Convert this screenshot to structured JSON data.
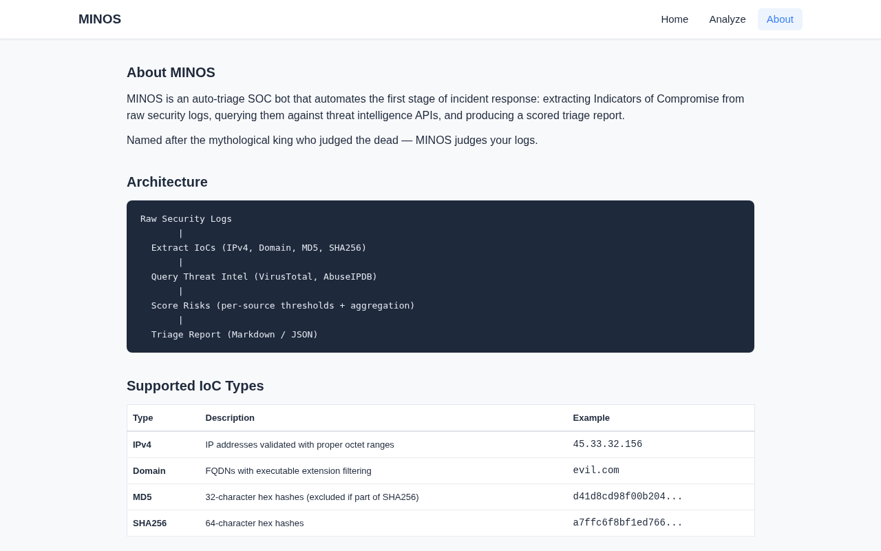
{
  "navbar": {
    "brand": "MINOS",
    "links": [
      {
        "label": "Home",
        "selected": false
      },
      {
        "label": "Analyze",
        "selected": false
      },
      {
        "label": "About",
        "selected": true
      }
    ]
  },
  "about": {
    "title": "About MINOS",
    "paragraphs": [
      "MINOS is an auto-triage SOC bot that automates the first stage of incident response: extracting Indicators of Compromise from raw security logs, querying them against threat intelligence APIs, and producing a scored triage report.",
      "Named after the mythological king who judged the dead — MINOS judges your logs."
    ]
  },
  "architecture": {
    "title": "Architecture",
    "lines": [
      {
        "kind": "source",
        "text": "Raw Security Logs"
      },
      {
        "kind": "connector",
        "text": "|"
      },
      {
        "kind": "step",
        "text": "Extract IoCs (IPv4, Domain, MD5, SHA256)"
      },
      {
        "kind": "connector",
        "text": "|"
      },
      {
        "kind": "step",
        "text": "Query Threat Intel (VirusTotal, AbuseIPDB)"
      },
      {
        "kind": "connector",
        "text": "|"
      },
      {
        "kind": "step",
        "text": "Score Risks (per-source thresholds + aggregation)"
      },
      {
        "kind": "connector",
        "text": "|"
      },
      {
        "kind": "step",
        "text": "Triage Report (Markdown / JSON)"
      }
    ]
  },
  "ioc_types": {
    "title": "Supported IoC Types",
    "columns": [
      "Type",
      "Description",
      "Example"
    ],
    "rows": [
      {
        "type": "IPv4",
        "description": "IP addresses validated with proper octet ranges",
        "example": "45.33.32.156"
      },
      {
        "type": "Domain",
        "description": "FQDNs with executable extension filtering",
        "example": "evil.com"
      },
      {
        "type": "MD5",
        "description": "32-character hex hashes (excluded if part of SHA256)",
        "example": "d41d8cd98f00b204..."
      },
      {
        "type": "SHA256",
        "description": "64-character hex hashes",
        "example": "a7ffc6f8bf1ed766..."
      }
    ]
  }
}
